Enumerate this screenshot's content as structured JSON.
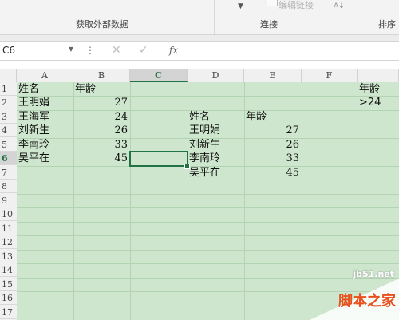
{
  "ribbon": {
    "ghost_text": "编辑链接",
    "group_external": "获取外部数据",
    "group_connect": "连接",
    "group_sort": "排序"
  },
  "formula_bar": {
    "name_box": "C6",
    "fx_label": "fx",
    "formula_value": ""
  },
  "columns": [
    "A",
    "B",
    "C",
    "D",
    "E",
    "F"
  ],
  "rows": [
    "1",
    "2",
    "3",
    "4",
    "5",
    "6",
    "7",
    "8",
    "9",
    "10",
    "11",
    "12",
    "13",
    "14",
    "15",
    "16",
    "17"
  ],
  "selected": {
    "column": "C",
    "row": "6"
  },
  "sheet": {
    "a_header": "姓名",
    "b_header": "年龄",
    "left_table": [
      {
        "name": "王明娟",
        "age": "27"
      },
      {
        "name": "王海军",
        "age": "24"
      },
      {
        "name": "刘新生",
        "age": "26"
      },
      {
        "name": "李南玲",
        "age": "33"
      },
      {
        "name": "吴平在",
        "age": "45"
      }
    ],
    "d_header": "姓名",
    "e_header": "年龄",
    "right_table": [
      {
        "name": "王明娟",
        "age": "27"
      },
      {
        "name": "刘新生",
        "age": "26"
      },
      {
        "name": "李南玲",
        "age": "33"
      },
      {
        "name": "吴平在",
        "age": "45"
      }
    ],
    "criteria_header": "年龄",
    "criteria_value": ">24"
  },
  "watermark": {
    "url": "jb51.net",
    "brand": "脚本之家"
  },
  "colors": {
    "grid_bg": "#cde6cd",
    "selection": "#217346"
  }
}
